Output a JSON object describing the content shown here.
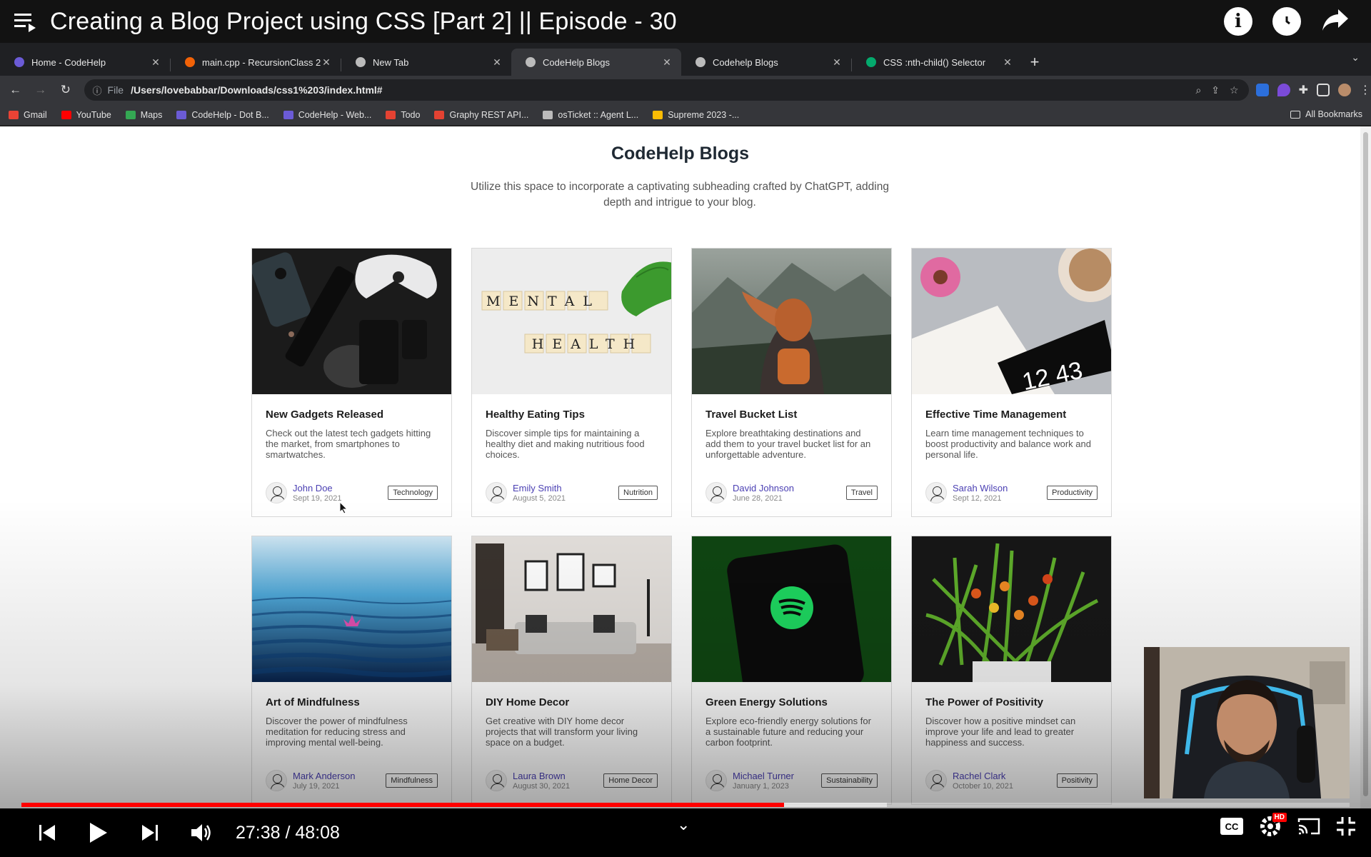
{
  "video": {
    "title": "Creating a Blog Project using CSS [Part 2] || Episode - 30",
    "time": "27:38 / 48:08",
    "progress": 0.5744
  },
  "browser": {
    "tabs": [
      {
        "label": "Home - CodeHelp",
        "icon": "codehelp-favicon",
        "color": "#6b5bd6"
      },
      {
        "label": "main.cpp - RecursionClass 2 ·",
        "icon": "replit-favicon",
        "color": "#f26207"
      },
      {
        "label": "New Tab",
        "icon": "globe-favicon",
        "color": "#bbbbbb"
      },
      {
        "label": "CodeHelp Blogs",
        "icon": "globe-favicon",
        "color": "#bbbbbb",
        "active": true
      },
      {
        "label": "Codehelp Blogs",
        "icon": "globe-favicon",
        "color": "#bbbbbb"
      },
      {
        "label": "CSS :nth-child() Selector",
        "icon": "w3schools-favicon",
        "color": "#04aa6d"
      }
    ],
    "address": {
      "scheme": "File",
      "url": "/Users/lovebabbar/Downloads/css1%203/index.html#"
    },
    "bookmarks": [
      {
        "label": "Gmail",
        "color": "#ea4335"
      },
      {
        "label": "YouTube",
        "color": "#ff0000"
      },
      {
        "label": "Maps",
        "color": "#34a853"
      },
      {
        "label": "CodeHelp - Dot B...",
        "color": "#6b5bd6"
      },
      {
        "label": "CodeHelp - Web...",
        "color": "#6b5bd6"
      },
      {
        "label": "Todo",
        "color": "#e44232"
      },
      {
        "label": "Graphy REST API...",
        "color": "#e44232"
      },
      {
        "label": "osTicket :: Agent L...",
        "color": "#bbbbbb"
      },
      {
        "label": "Supreme 2023 -...",
        "color": "#fbbc04"
      }
    ],
    "all_bookmarks": "All Bookmarks"
  },
  "page": {
    "title": "CodeHelp Blogs",
    "subtitle": "Utilize this space to incorporate a captivating subheading crafted by ChatGPT, adding depth and intrigue to your blog."
  },
  "cards": [
    {
      "title": "New Gadgets Released",
      "desc": "Check out the latest tech gadgets hitting the market, from smartphones to smartwatches.",
      "author": "John Doe",
      "date": "Sept 19, 2021",
      "tag": "Technology",
      "image": "gadgets"
    },
    {
      "title": "Healthy Eating Tips",
      "desc": "Discover simple tips for maintaining a healthy diet and making nutritious food choices.",
      "author": "Emily Smith",
      "date": "August 5, 2021",
      "tag": "Nutrition",
      "image": "mental-health"
    },
    {
      "title": "Travel Bucket List",
      "desc": "Explore breathtaking destinations and add them to your travel bucket list for an unforgettable adventure.",
      "author": "David Johnson",
      "date": "June 28, 2021",
      "tag": "Travel",
      "image": "mountains"
    },
    {
      "title": "Effective Time Management",
      "desc": "Learn time management techniques to boost productivity and balance work and personal life.",
      "author": "Sarah Wilson",
      "date": "Sept 12, 2021",
      "tag": "Productivity",
      "image": "clock"
    },
    {
      "title": "Art of Mindfulness",
      "desc": "Discover the power of mindfulness meditation for reducing stress and improving mental well-being.",
      "author": "Mark Anderson",
      "date": "July 19, 2021",
      "tag": "Mindfulness",
      "image": "water"
    },
    {
      "title": "DIY Home Decor",
      "desc": "Get creative with DIY home decor projects that will transform your living space on a budget.",
      "author": "Laura Brown",
      "date": "August 30, 2021",
      "tag": "Home Decor",
      "image": "living-room"
    },
    {
      "title": "Green Energy Solutions",
      "desc": "Explore eco-friendly energy solutions for a sustainable future and reducing your carbon footprint.",
      "author": "Michael Turner",
      "date": "January 1, 2023",
      "tag": "Sustainability",
      "image": "spotify-phone"
    },
    {
      "title": "The Power of Positivity",
      "desc": "Discover how a positive mindset can improve your life and lead to greater happiness and success.",
      "author": "Rachel Clark",
      "date": "October 10, 2021",
      "tag": "Positivity",
      "image": "flowers"
    }
  ],
  "photo_text": {
    "mental": "MENTAL",
    "health": "HEALTH",
    "clock": "12 43"
  }
}
